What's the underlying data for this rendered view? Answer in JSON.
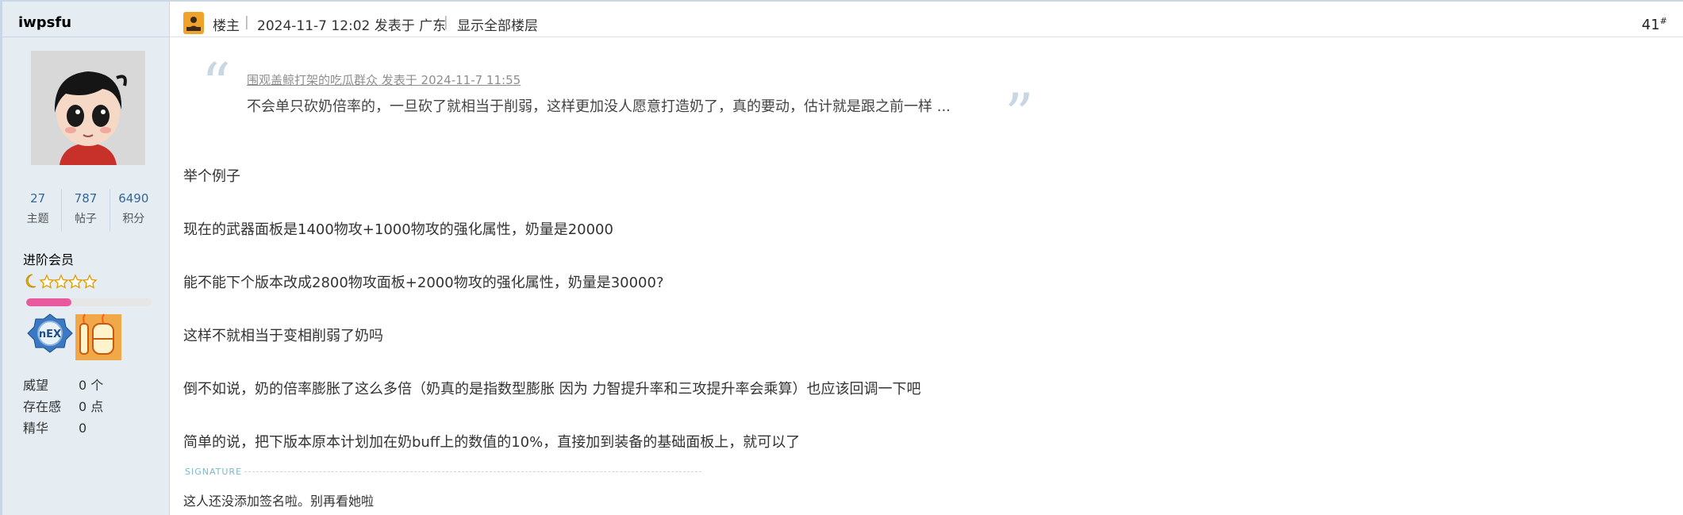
{
  "user": {
    "name": "iwpsfu",
    "stats": [
      {
        "value": "27",
        "label": "主题"
      },
      {
        "value": "787",
        "label": "帖子"
      },
      {
        "value": "6490",
        "label": "积分"
      }
    ],
    "rank": "进阶会员",
    "rank_progress": 0.36,
    "info": [
      {
        "key": "威望",
        "value": "0 个"
      },
      {
        "key": "存在感",
        "value": "0 点"
      },
      {
        "key": "精华",
        "value": "0"
      }
    ]
  },
  "post_header": {
    "op_label": "楼主",
    "posted_at": "2024-11-7 12:02 发表于 广东",
    "show_all_link": "显示全部楼层",
    "floor_number": "41",
    "floor_mark": "#"
  },
  "quote": {
    "author_line": "围观盖鲸打架的吃瓜群众 发表于 2024-11-7 11:55",
    "text": "不会单只砍奶倍率的，一旦砍了就相当于削弱，这样更加没人愿意打造奶了，真的要动，估计就是跟之前一样 ..."
  },
  "body": [
    "举个例子",
    "现在的武器面板是1400物攻+1000物攻的强化属性，奶量是20000",
    "能不能下个版本改成2800物攻面板+2000物攻的强化属性，奶量是30000?",
    "这样不就相当于变相削弱了奶吗",
    "倒不如说，奶的倍率膨胀了这么多倍（奶真的是指数型膨胀 因为 力智提升率和三攻提升率会乘算）也应该回调一下吧",
    "简单的说，把下版本原本计划加在奶buff上的数值的10%，直接加到装备的基础面板上，就可以了"
  ],
  "signature": {
    "label": "SIGNATURE",
    "text": "这人还没添加签名啦。别再看她啦"
  },
  "colors": {
    "sidebar_bg": "#e5edf2",
    "link": "#336699",
    "progress": "#e85a9d",
    "op_icon": "#f0a32a"
  }
}
